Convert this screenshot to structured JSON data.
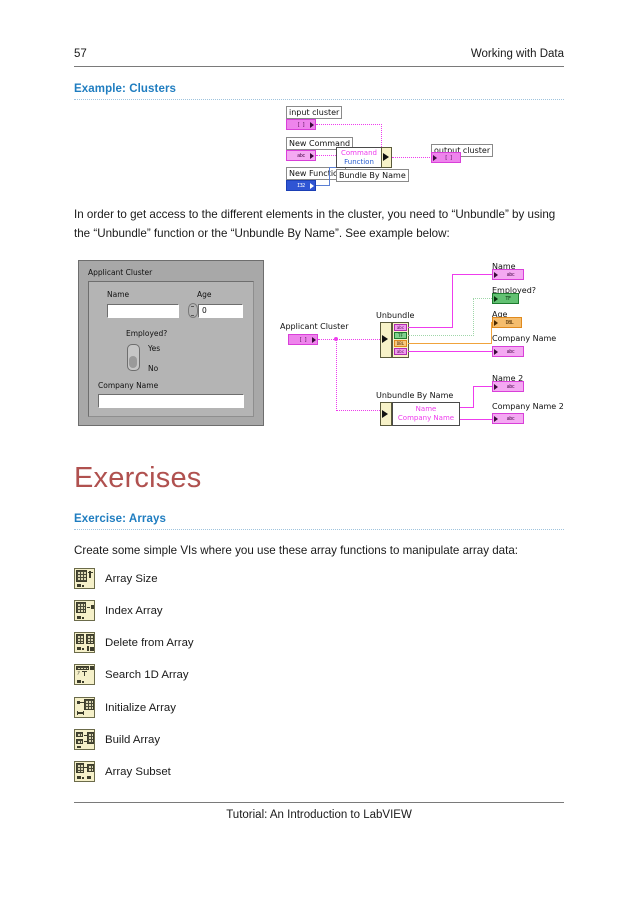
{
  "page": {
    "number": "57",
    "header_right": "Working with Data",
    "footer": "Tutorial: An Introduction to LabVIEW"
  },
  "sections": {
    "example_clusters": {
      "heading": "Example: Clusters"
    },
    "exercises": {
      "heading": "Exercises"
    },
    "exercise_arrays": {
      "heading": "Exercise: Arrays",
      "intro": "Create some simple VIs where you use these array functions to manipulate array data:"
    }
  },
  "body": {
    "unbundle_paragraph": "In order to get access to the different elements in the cluster, you need to “Unbundle” by using the “Unbundle” function or the “Unbundle By Name”. See example below:"
  },
  "diagram_bundle": {
    "caption_input_cluster": "input cluster",
    "caption_new_command": "New Command",
    "caption_new_function": "New Function",
    "caption_output_cluster": "output cluster",
    "node_rows": [
      "Command",
      "Function"
    ],
    "node_title": "Bundle By Name",
    "terminals": {
      "input_cluster_glyph": "[  ]",
      "new_command_glyph": "abc",
      "new_function_glyph": "I32",
      "output_cluster_glyph": "[  ]"
    },
    "colors": {
      "cluster": "#ee84ec",
      "string": "#f4a9f2",
      "integer": "#2f55d4",
      "wire_pink": "#ee3ced",
      "wire_blue": "#5b7fd4",
      "node_body": "#f7f2c8"
    }
  },
  "front_panel": {
    "title": "Applicant Cluster",
    "fields": {
      "name_label": "Name",
      "name_value": "",
      "age_label": "Age",
      "age_value": "0",
      "employed_label": "Employed?",
      "employed_yes": "Yes",
      "employed_no": "No",
      "company_label": "Company Name",
      "company_value": ""
    }
  },
  "diagram_unbundle": {
    "source_label": "Applicant Cluster",
    "unbundle_title": "Unbundle",
    "unbundle_by_name_title": "Unbundle By Name",
    "by_name_rows": [
      "Name",
      "Company Name"
    ],
    "indicators": [
      {
        "label": "Name",
        "type": "abc",
        "glyph": "abc"
      },
      {
        "label": "Employed?",
        "type": "TF",
        "glyph": "TF"
      },
      {
        "label": "Age",
        "type": "DBL",
        "glyph": "DBL"
      },
      {
        "label": "Company Name",
        "type": "abc",
        "glyph": "abc"
      },
      {
        "label": "Name 2",
        "type": "abc",
        "glyph": "abc"
      },
      {
        "label": "Company Name 2",
        "type": "abc",
        "glyph": "abc"
      }
    ],
    "unbundle_outputs": [
      "abc",
      "TF",
      "DBL",
      "abc"
    ],
    "colors": {
      "string": "#f4a9f2",
      "boolean": "#62c172",
      "double": "#f5bd6d",
      "wire_pink": "#ee3ced",
      "wire_green": "#9fd6a8",
      "wire_orange": "#f0a33c"
    }
  },
  "array_functions": [
    {
      "name": "Array Size",
      "icon": "array-size-icon"
    },
    {
      "name": "Index Array",
      "icon": "index-array-icon"
    },
    {
      "name": "Delete from Array",
      "icon": "delete-from-array-icon"
    },
    {
      "name": "Search 1D Array",
      "icon": "search-1d-array-icon"
    },
    {
      "name": "Initialize Array",
      "icon": "initialize-array-icon"
    },
    {
      "name": "Build Array",
      "icon": "build-array-icon"
    },
    {
      "name": "Array Subset",
      "icon": "array-subset-icon"
    }
  ],
  "theme": {
    "heading_blue": "#1f7dc0",
    "title_red": "#b0514f",
    "rule_gray": "#7a7a7a"
  }
}
